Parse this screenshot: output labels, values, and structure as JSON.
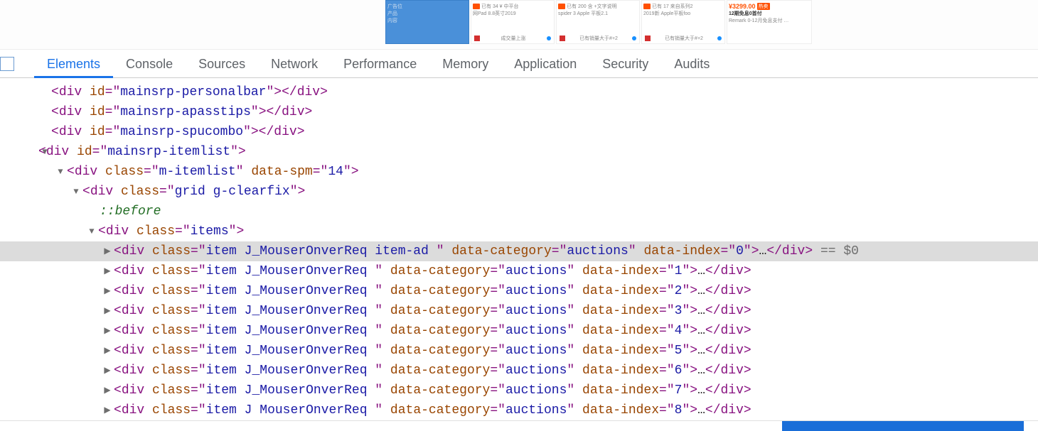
{
  "top": {
    "selected_card": {
      "line1": "广告位",
      "line2": "产品",
      "line3": "内容"
    },
    "cards": [
      {
        "t1": "已有 34 ¥ 中平台",
        "t2": "网Pad 8.8英寸2019",
        "foot": "成交量上涨"
      },
      {
        "t1": "已有 200 含 +文字说明",
        "t2": "spider 3 Apple 平板2.1",
        "foot": "已有销量大于#+2"
      },
      {
        "t1": "已有 17 来自系列2",
        "t2": "2019新 Apple平板foo",
        "foot": "已有销量大于#+2"
      }
    ],
    "big_card": {
      "price": "¥3299.00",
      "badge": "热卖",
      "title": "12期免息0首付",
      "sub": "Remark 0-12月免息支付 …"
    }
  },
  "tabs": [
    "Elements",
    "Console",
    "Sources",
    "Network",
    "Performance",
    "Memory",
    "Application",
    "Security",
    "Audits"
  ],
  "active_tab": 0,
  "dom": {
    "l1": {
      "tag": "div",
      "attr": "id",
      "val": "mainsrp-personalbar"
    },
    "l2": {
      "tag": "div",
      "attr": "id",
      "val": "mainsrp-apasstips"
    },
    "l3": {
      "tag": "div",
      "attr": "id",
      "val": "mainsrp-spucombo"
    },
    "l4": {
      "tag": "div",
      "attr": "id",
      "val": "mainsrp-itemlist"
    },
    "l5": {
      "tag": "div",
      "attr1": "class",
      "val1": "m-itemlist",
      "attr2": "data-spm",
      "val2": "14"
    },
    "l6": {
      "tag": "div",
      "attr": "class",
      "val": "grid g-clearfix"
    },
    "l7": "::before",
    "l8": {
      "tag": "div",
      "attr": "class",
      "val": "items"
    },
    "hl": {
      "tag": "div",
      "cls": "item J_MouserOnverReq item-ad  ",
      "cat_k": "data-category",
      "cat_v": "auctions",
      "idx_k": "data-index",
      "idx_v": "0",
      "suffix": "== $0"
    },
    "items": [
      {
        "cls": "item J_MouserOnverReq  ",
        "idx": "1"
      },
      {
        "cls": "item J_MouserOnverReq  ",
        "idx": "2"
      },
      {
        "cls": "item J_MouserOnverReq  ",
        "idx": "3"
      },
      {
        "cls": "item J_MouserOnverReq  ",
        "idx": "4"
      },
      {
        "cls": "item J_MouserOnverReq  ",
        "idx": "5"
      },
      {
        "cls": "item J_MouserOnverReq  ",
        "idx": "6"
      },
      {
        "cls": "item J_MouserOnverReq  ",
        "idx": "7"
      },
      {
        "cls": "item J MouserOnverReq  ",
        "idx": "8"
      }
    ],
    "common": {
      "class_k": "class",
      "cat_k": "data-category",
      "cat_v": "auctions",
      "idx_k": "data-index",
      "tag": "div"
    }
  }
}
